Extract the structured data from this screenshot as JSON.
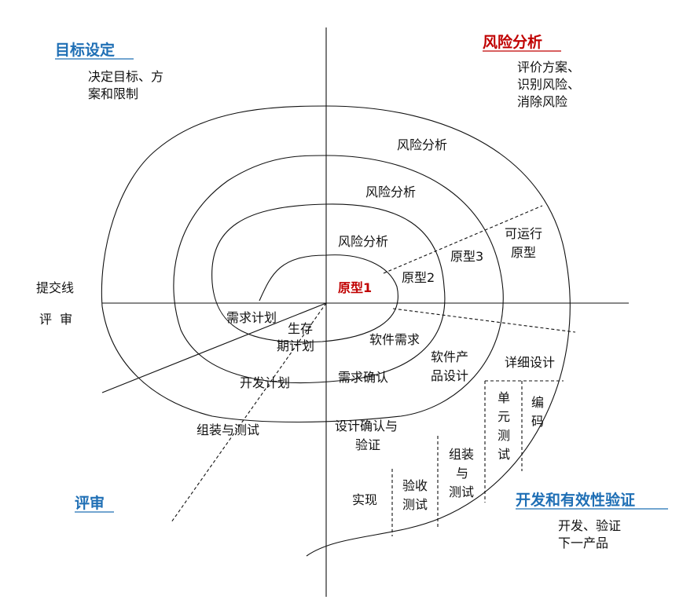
{
  "quadrants": {
    "top_left": {
      "title": "目标设定",
      "desc": [
        "决定目标、方",
        "案和限制"
      ]
    },
    "top_right": {
      "title": "风险分析",
      "desc": [
        "评价方案、",
        "识别风险、",
        "消除风险"
      ]
    },
    "bottom_left": {
      "title": "评审"
    },
    "bottom_right": {
      "title": "开发和有效性验证",
      "desc": [
        "开发、验证",
        "下一产品"
      ]
    }
  },
  "axis_labels": {
    "commit": "提交线",
    "review": "评  审"
  },
  "risk_labels": [
    "风险分析",
    "风险分析",
    "风险分析"
  ],
  "prototypes": {
    "p1": "原型1",
    "p2": "原型2",
    "p3": "原型3",
    "operational": [
      "可运行",
      "原型"
    ]
  },
  "plans": {
    "requirements": "需求计划",
    "lifecycle": [
      "生存",
      "期计划"
    ],
    "development": "开发计划",
    "integration": "组装与测试"
  },
  "products": {
    "software_requirements": "软件需求",
    "requirements_validation": "需求确认",
    "product_design": [
      "软件产",
      "品设计"
    ],
    "design_validation": [
      "设计确认与",
      "验证"
    ],
    "detailed_design": "详细设计",
    "unit_test": [
      "单",
      "元",
      "测",
      "试"
    ],
    "coding": [
      "编",
      "码"
    ],
    "integration_test": [
      "组装",
      "与",
      "测试"
    ],
    "acceptance_test": [
      "验收",
      "测试"
    ],
    "implementation": "实现"
  }
}
